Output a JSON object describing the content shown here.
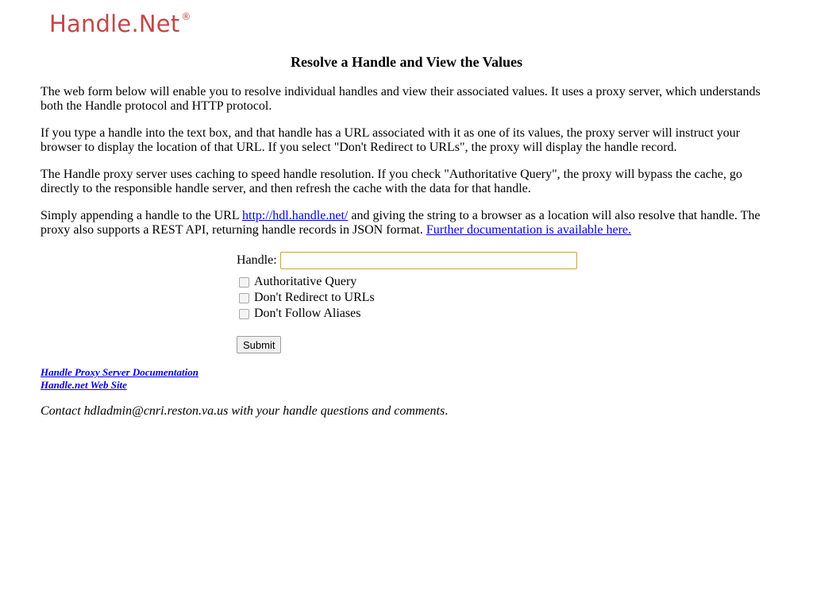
{
  "logo": {
    "text": "Handle.Net",
    "registered": "®"
  },
  "page_title": "Resolve a Handle and View the Values",
  "paragraphs": {
    "p1": "The web form below will enable you to resolve individual handles and view their associated values. It uses a proxy server, which understands both the Handle protocol and HTTP protocol.",
    "p2": "If you type a handle into the text box, and that handle has a URL associated with it as one of its values, the proxy server will instruct your browser to display the location of that URL.  If you select \"Don't Redirect to URLs\", the proxy will display the handle record.",
    "p3": "The Handle proxy server uses caching to speed handle resolution. If you check \"Authoritative Query\", the proxy will bypass the cache, go directly to the responsible handle server, and then refresh the cache with the data for that handle.",
    "p4_before": "Simply appending a handle to the URL ",
    "p4_link": "http://hdl.handle.net/",
    "p4_middle": " and giving the string to a browser as a location will also resolve that handle. The proxy also supports a REST API, returning handle records in JSON format. ",
    "p4_doc_link": "Further documentation is available here."
  },
  "form": {
    "handle_label": "Handle:",
    "handle_value": "",
    "options": [
      {
        "label": "Authoritative Query",
        "checked": false
      },
      {
        "label": "Don't Redirect to URLs",
        "checked": false
      },
      {
        "label": "Don't Follow Aliases",
        "checked": false
      }
    ],
    "submit_label": "Submit"
  },
  "footer_links": {
    "docs": "Handle Proxy Server Documentation",
    "site": "Handle.net Web Site"
  },
  "contact": {
    "before": "Contact hdladmin@cnri.reston.va.us with your handle questions and comments",
    "after": "."
  },
  "colors": {
    "logo": "#c24848",
    "link": "#0000ee",
    "input_border": "#c9a24b"
  }
}
